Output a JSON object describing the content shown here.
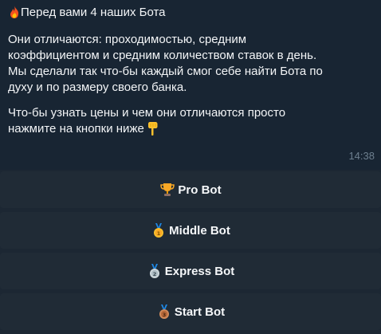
{
  "message": {
    "line1_icon": "fire-icon",
    "line1": "Перед вами 4 наших Бота",
    "para1": [
      "Они отличаются: проходимостью, средним",
      "коэффициентом и средним количеством ставок в день.",
      "Мы сделали так что-бы каждый смог себе найти Бота по",
      "духу и по размеру своего банка."
    ],
    "para2": [
      "Что-бы узнать цены и чем они отличаются просто",
      "нажмите на кнопки ниже"
    ],
    "pointing_icon": "pointing-down-icon",
    "time": "14:38"
  },
  "buttons": [
    {
      "label": "Pro Bot",
      "icon": "trophy-icon"
    },
    {
      "label": "Middle Bot",
      "icon": "gold-medal-icon"
    },
    {
      "label": "Express Bot",
      "icon": "silver-medal-icon"
    },
    {
      "label": "Start Bot",
      "icon": "bronze-medal-icon"
    }
  ],
  "colors": {
    "background": "#182533",
    "button": "#202b36",
    "timestamp": "#6d7f8f"
  }
}
